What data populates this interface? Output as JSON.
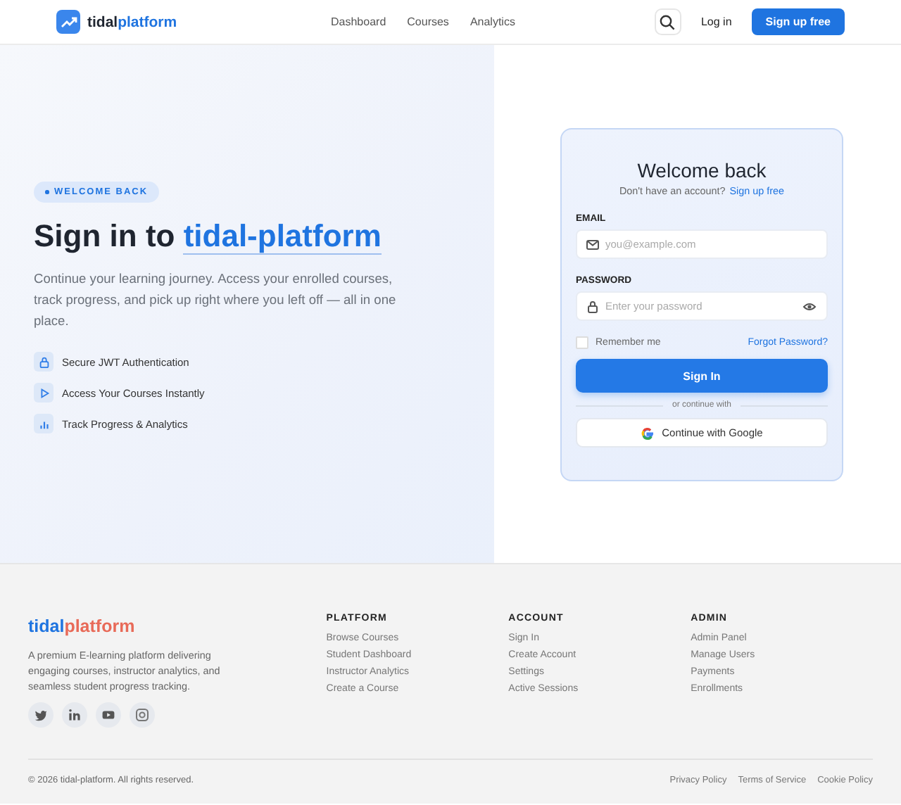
{
  "nav": {
    "brand": {
      "first": "tidal",
      "second": "platform"
    },
    "links": [
      "Dashboard",
      "Courses",
      "Analytics"
    ],
    "login": "Log in",
    "signup": "Sign up free"
  },
  "hero": {
    "badge": "WELCOME BACK",
    "heading": "Sign in to",
    "highlight": "tidal-platform",
    "intro": "Continue your learning journey. Access your enrolled courses, track progress, and pick up right where you left off — all in one place.",
    "features": [
      {
        "kind": "lock",
        "label": "Secure JWT Authentication"
      },
      {
        "kind": "play",
        "label": "Access Your Courses Instantly"
      },
      {
        "kind": "chart",
        "label": "Track Progress & Analytics"
      }
    ]
  },
  "form": {
    "title": "Welcome back",
    "prompt": "Don't have an account?",
    "prompt_link": "Sign up free",
    "email": {
      "label": "EMAIL",
      "placeholder": "you@example.com"
    },
    "password": {
      "label": "PASSWORD",
      "placeholder": "Enter your password"
    },
    "remember": {
      "label": "Remember me",
      "checked": false
    },
    "forgot": "Forgot Password?",
    "submit": "Sign In",
    "divider": "or continue with",
    "google": "Continue with Google"
  },
  "footer": {
    "brand": {
      "first": "tidal",
      "second": "platform"
    },
    "about": "A premium E-learning platform delivering engaging courses, instructor analytics, and seamless student progress tracking.",
    "social": [
      {
        "kind": "twitter"
      },
      {
        "kind": "linkedin"
      },
      {
        "kind": "youtube"
      },
      {
        "kind": "instagram"
      }
    ],
    "columns": [
      {
        "title": "PLATFORM",
        "links": [
          "Browse Courses",
          "Student Dashboard",
          "Instructor Analytics",
          "Create a Course"
        ]
      },
      {
        "title": "ACCOUNT",
        "links": [
          "Sign In",
          "Create Account",
          "Settings",
          "Active Sessions"
        ]
      },
      {
        "title": "ADMIN",
        "links": [
          "Admin Panel",
          "Manage Users",
          "Payments",
          "Enrollments"
        ]
      }
    ],
    "copyright": "© 2026 tidal-platform. All rights reserved.",
    "legal": [
      "Privacy Policy",
      "Terms of Service",
      "Cookie Policy"
    ]
  }
}
